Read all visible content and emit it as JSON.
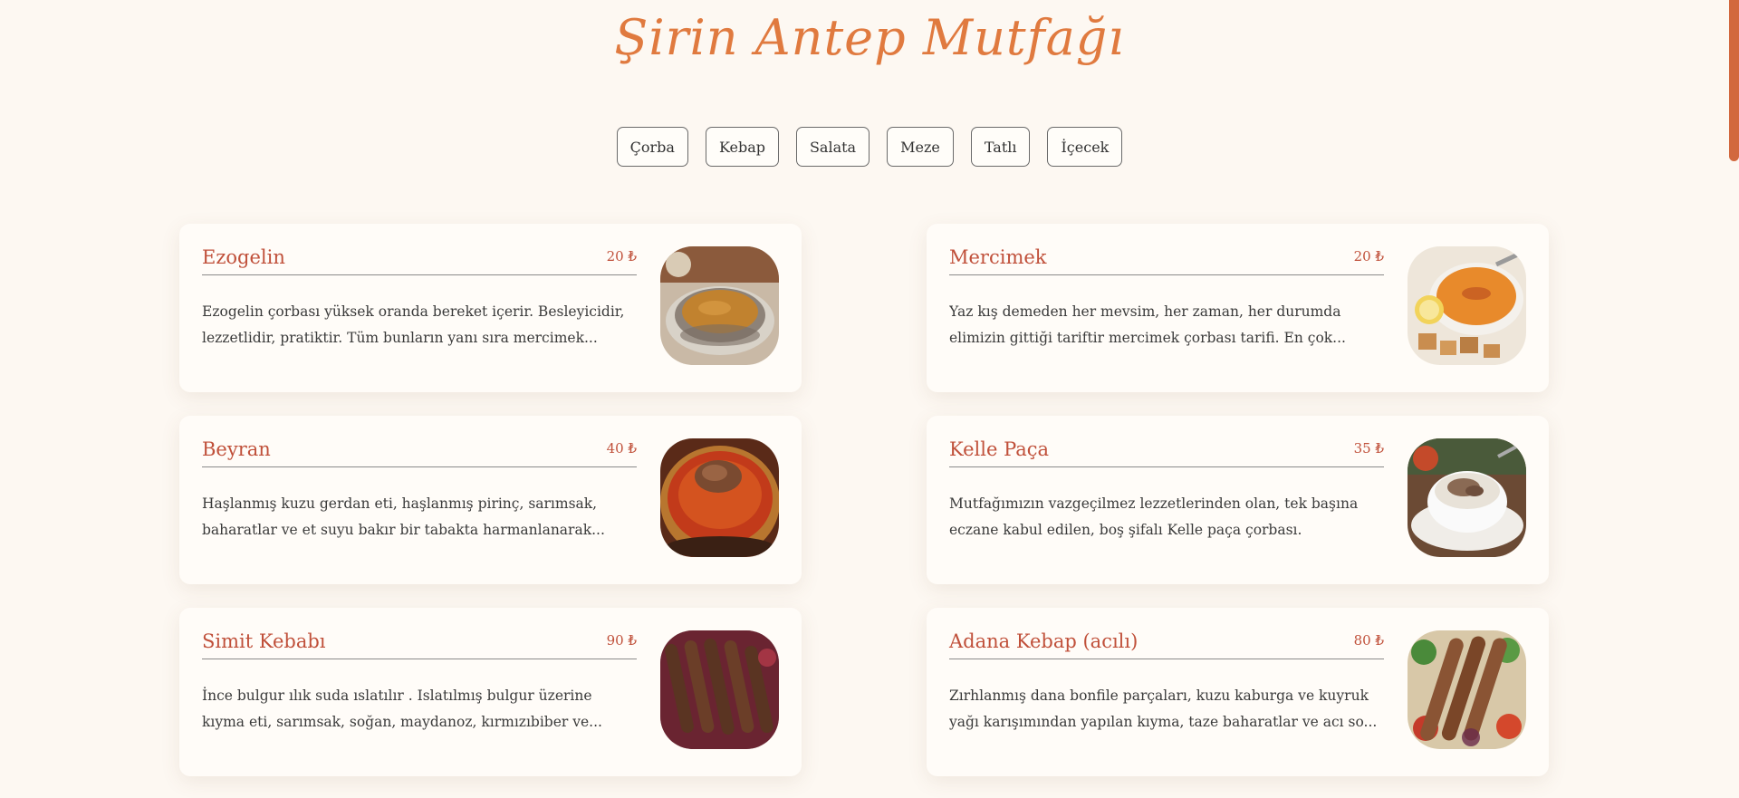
{
  "title": "Şirin Antep Mutfağı",
  "accent_color": "#e07a3f",
  "name_color": "#c0503a",
  "tabs": [
    {
      "label": "Çorba"
    },
    {
      "label": "Kebap"
    },
    {
      "label": "Salata"
    },
    {
      "label": "Meze"
    },
    {
      "label": "Tatlı"
    },
    {
      "label": "İçecek"
    }
  ],
  "items": [
    {
      "name": "Ezogelin",
      "price": "20 ₺",
      "desc": "Ezogelin çorbası yüksek oranda bereket içerir. Besleyicidir, lezzetlidir, pratiktir. Tüm bunların yanı sıra mercimek...",
      "image": "ezogelin-soup-image"
    },
    {
      "name": "Mercimek",
      "price": "20 ₺",
      "desc": "Yaz kış demeden her mevsim, her zaman, her durumda elimizin gittiği tariftir mercimek çorbası tarifi. En çok...",
      "image": "lentil-soup-image"
    },
    {
      "name": "Beyran",
      "price": "40 ₺",
      "desc": "Haşlanmış kuzu gerdan eti, haşlanmış pirinç, sarımsak, baharatlar ve et suyu bakır bir tabakta harmanlanarak...",
      "image": "beyran-soup-image"
    },
    {
      "name": "Kelle Paça",
      "price": "35 ₺",
      "desc": "Mutfağımızın vazgeçilmez lezzetlerinden olan, tek başına eczane kabul edilen, boş şifalı Kelle paça çorbası.",
      "image": "kelle-paca-image"
    },
    {
      "name": "Simit Kebabı",
      "price": "90 ₺",
      "desc": "İnce bulgur ılık suda ıslatılır . Islatılmış bulgur üzerine kıyma eti, sarımsak, soğan, maydanoz, kırmızıbiber ve...",
      "image": "simit-kebab-image"
    },
    {
      "name": "Adana Kebap (acılı)",
      "price": "80 ₺",
      "desc": "Zırhlanmış dana bonfile parçaları, kuzu kaburga ve kuyruk yağı karışımından yapılan kıyma, taze baharatlar ve acı so...",
      "image": "adana-kebab-image"
    }
  ]
}
